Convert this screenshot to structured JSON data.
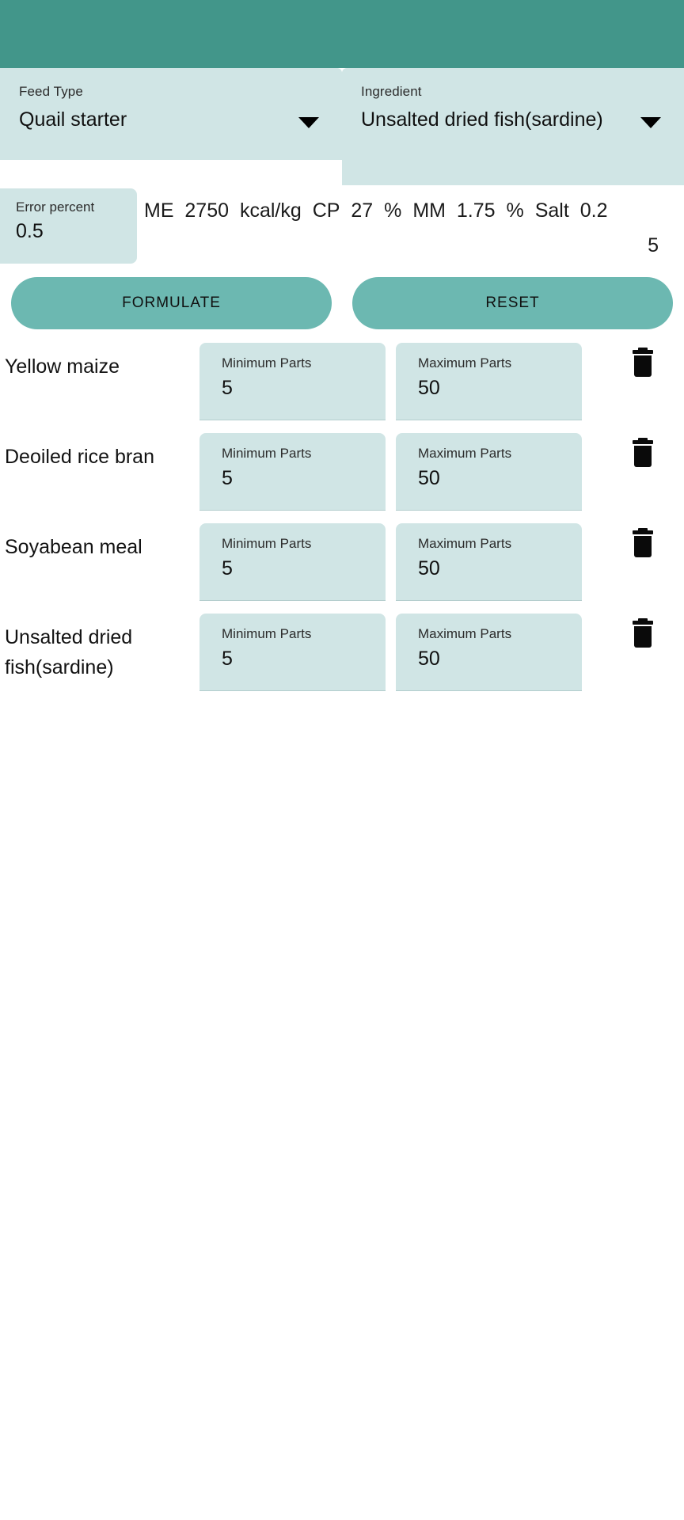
{
  "theme": {
    "appbar_color": "#42968a",
    "field_color": "#d0e5e5",
    "button_color": "#6cb8b1",
    "text_color": "#101010"
  },
  "appbar": {
    "title": ""
  },
  "selectors": {
    "feed_type": {
      "label": "Feed Type",
      "value": "Quail starter",
      "arrow_icon": "chevron-down-icon"
    },
    "ingredient": {
      "label": "Ingredient",
      "value": "Unsalted dried fish(sardine)",
      "arrow_icon": "chevron-down-icon"
    }
  },
  "error_percent": {
    "label": "Error percent",
    "value": "0.5"
  },
  "nutrients": [
    {
      "name": "ME",
      "value": "2750",
      "unit": "kcal/kg"
    },
    {
      "name": "CP",
      "value": "27",
      "unit": "%"
    },
    {
      "name": "MM",
      "value": "1.75",
      "unit": "%"
    },
    {
      "name": "Salt",
      "value": "0.2",
      "unit": ""
    }
  ],
  "nutrients_wrap_fragment": "5",
  "buttons": {
    "formulate": "FORMULATE",
    "reset": "RESET"
  },
  "ingredient_rows": [
    {
      "name": "Yellow maize",
      "min_label": "Minimum Parts",
      "min_value": "5",
      "max_label": "Maximum Parts",
      "max_value": "50",
      "delete_icon": "trash-icon"
    },
    {
      "name": "Deoiled rice bran",
      "min_label": "Minimum Parts",
      "min_value": "5",
      "max_label": "Maximum Parts",
      "max_value": "50",
      "delete_icon": "trash-icon"
    },
    {
      "name": "Soyabean meal",
      "min_label": "Minimum Parts",
      "min_value": "5",
      "max_label": "Maximum Parts",
      "max_value": "50",
      "delete_icon": "trash-icon"
    },
    {
      "name": "Unsalted dried fish(sardine)",
      "min_label": "Minimum Parts",
      "min_value": "5",
      "max_label": "Maximum Parts",
      "max_value": "50",
      "delete_icon": "trash-icon"
    }
  ]
}
